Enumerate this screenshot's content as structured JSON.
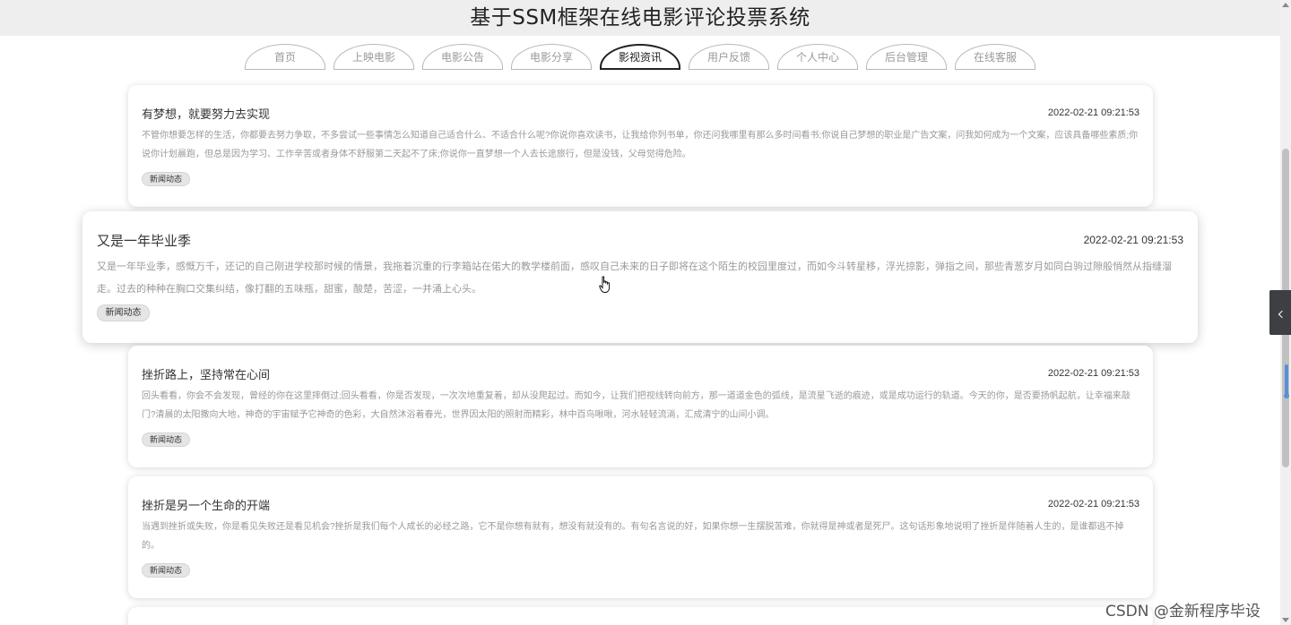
{
  "header": {
    "title": "基于SSM框架在线电影评论投票系统"
  },
  "nav": [
    {
      "label": "首页"
    },
    {
      "label": "上映电影"
    },
    {
      "label": "电影公告"
    },
    {
      "label": "电影分享"
    },
    {
      "label": "影视资讯",
      "active": true
    },
    {
      "label": "用户反馈"
    },
    {
      "label": "个人中心"
    },
    {
      "label": "后台管理"
    },
    {
      "label": "在线客服"
    }
  ],
  "news": [
    {
      "title": "有梦想，就要努力去实现",
      "date": "2022-02-21 09:21:53",
      "body": "不管你想要怎样的生活，你都要去努力争取，不多尝试一些事情怎么知道自己适合什么、不适合什么呢?你说你喜欢读书，让我给你列书单，你还问我哪里有那么多时间看书;你说自己梦想的职业是广告文案，问我如何成为一个文案，应该具备哪些素质;你说你计划晨跑，但总是因为学习、工作辛苦或者身体不舒服第二天起不了床;你说你一直梦想一个人去长途旅行，但是没钱，父母觉得危险。",
      "tag": "新闻动态"
    },
    {
      "title": "又是一年毕业季",
      "date": "2022-02-21 09:21:53",
      "body": "又是一年毕业季，感慨万千，还记的自己刚进学校那时候的情景，我拖着沉重的行李箱站在偌大的教学楼前面，感叹自己未来的日子即将在这个陌生的校园里度过，而如今斗转星移，浮光掠影，弹指之间，那些青葱岁月如同白驹过隙般悄然从指缝溜走。过去的种种在胸口交集纠结，像打翻的五味瓶，甜蜜，酸楚，苦涩，一并涌上心头。",
      "tag": "新闻动态"
    },
    {
      "title": "挫折路上，坚持常在心间",
      "date": "2022-02-21 09:21:53",
      "body": "回头看看，你会不会发现，曾经的你在这里摔倒过;回头看看，你是否发现，一次次地重复着，却从没爬起过。而如今，让我们把视线转向前方，那一道道金色的弧线，是流星飞逝的痕迹，或是成功运行的轨道。今天的你，是否要扬帆起航，让幸福来敲门?清晨的太阳撒向大地，神奇的宇宙赋予它神奇的色彩，大自然沐浴着春光，世界因太阳的照射而精彩，林中百鸟啾啾，河水轻轻流淌，汇成清宁的山间小调。",
      "tag": "新闻动态"
    },
    {
      "title": "挫折是另一个生命的开端",
      "date": "2022-02-21 09:21:53",
      "body": "当遇到挫折或失败，你是看见失败还是看见机会?挫折是我们每个人成长的必经之路，它不是你想有就有，想没有就没有的。有句名言说的好，如果你想一生摆脱苦难，你就得是神或者是死尸。这句话形象地说明了挫折是伴随着人生的，是谁都逃不掉的。",
      "tag": "新闻动态"
    }
  ],
  "watermark": "CSDN @金新程序毕设",
  "icons": {
    "sidebar_toggle": "chevron-left-icon",
    "cursor": "hand-pointer-icon"
  }
}
